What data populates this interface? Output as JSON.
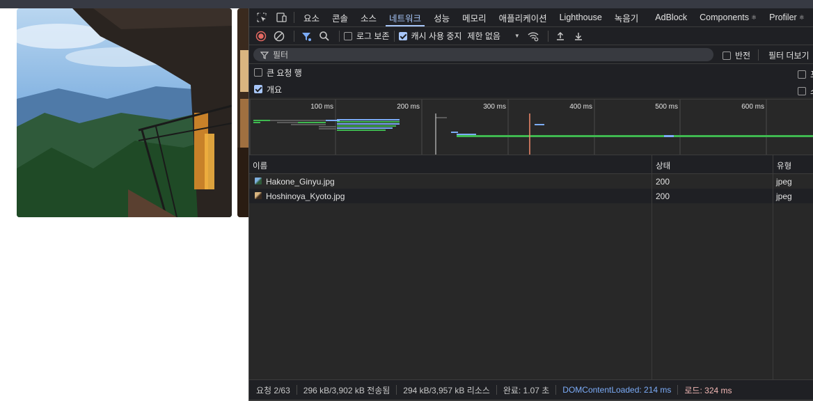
{
  "devtools": {
    "tabs": [
      {
        "label": "요소"
      },
      {
        "label": "콘솔"
      },
      {
        "label": "소스"
      },
      {
        "label": "네트워크",
        "active": true
      },
      {
        "label": "성능"
      },
      {
        "label": "메모리"
      },
      {
        "label": "애플리케이션"
      },
      {
        "label": "Lighthouse"
      },
      {
        "label": "녹음기"
      },
      {
        "label": "AdBlock"
      },
      {
        "label": "Components"
      },
      {
        "label": "Profiler"
      }
    ],
    "toolbar": {
      "preserve_log": "로그 보존",
      "disable_cache": "캐시 사용 중지",
      "throttling": "제한 없음"
    },
    "filter": {
      "placeholder": "필터",
      "invert": "반전",
      "more_filters": "필터 더보기"
    },
    "options": {
      "big_request_rows": "큰 요청 행",
      "overview": "개요"
    },
    "overview_ticks": [
      "100 ms",
      "200 ms",
      "300 ms",
      "400 ms",
      "500 ms",
      "600 ms"
    ],
    "table": {
      "columns": [
        "이름",
        "상태",
        "유형"
      ],
      "rows": [
        {
          "name": "Hakone_Ginyu.jpg",
          "status": "200",
          "type": "jpeg"
        },
        {
          "name": "Hoshinoya_Kyoto.jpg",
          "status": "200",
          "type": "jpeg"
        }
      ]
    },
    "status": {
      "requests": "요청 2/63",
      "transferred": "296 kB/3,902 kB 전송됨",
      "resources": "294 kB/3,957 kB 리소스",
      "finish": "완료: 1.07 초",
      "dom_content_loaded": "DOMContentLoaded: 214 ms",
      "load": "로드: 324 ms"
    },
    "colors": {
      "accent": "#a8c7fa",
      "dom_line": "#7cacf8",
      "load_line": "#f2b8b5",
      "record": "#e46962"
    }
  }
}
